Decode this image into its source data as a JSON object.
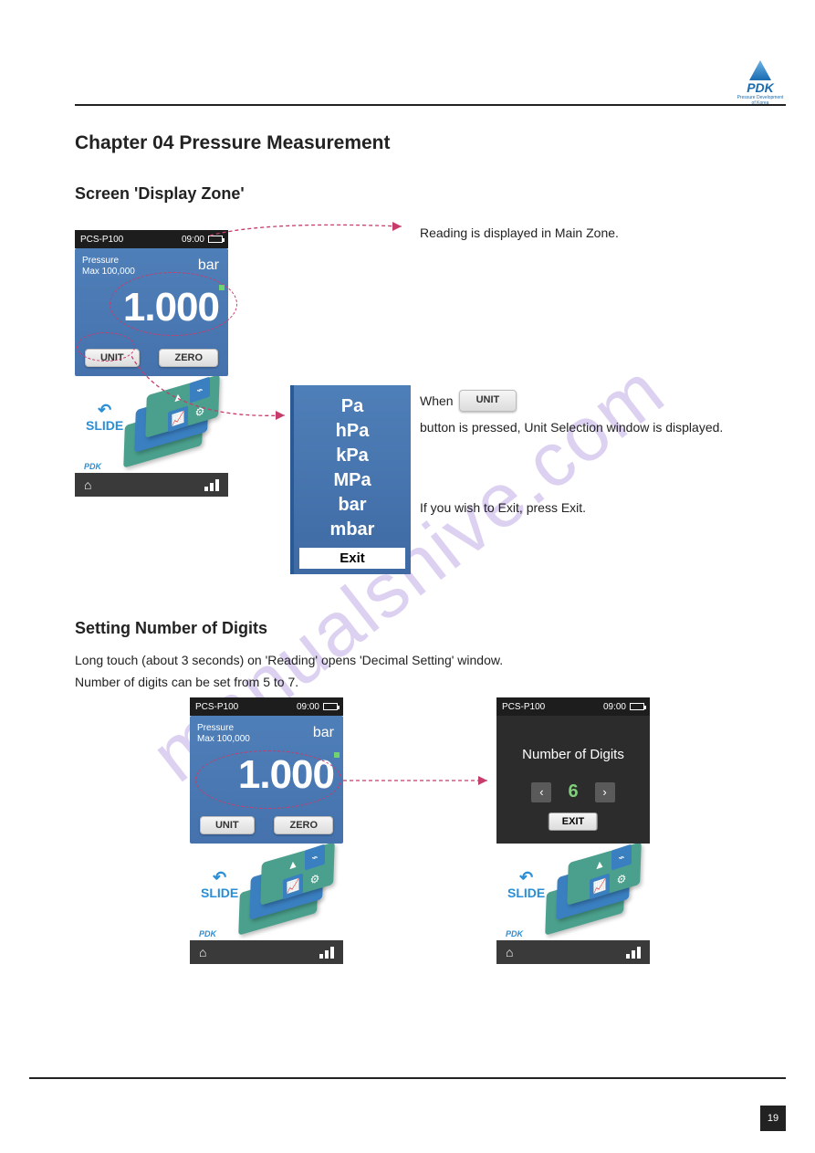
{
  "brand": {
    "name": "PDK",
    "tagline": "Pressure Development of Korea",
    "mark": "PDK"
  },
  "watermark": "manualshive.com",
  "page_number": "19",
  "section": "Chapter 04 Pressure Measurement",
  "seg1": {
    "heading": "Screen 'Display Zone'",
    "text1": "Reading is displayed in Main Zone.",
    "text2_a": "When ",
    "text2_b": " button is pressed, Unit Selection window is displayed.",
    "text3": "If you wish to Exit, press Exit."
  },
  "seg2": {
    "heading": "Setting Number of Digits",
    "text1": "Long touch (about 3 seconds) on 'Reading' opens 'Decimal Setting' window.",
    "text2": "Number of digits can be set from 5 to 7."
  },
  "device": {
    "model": "PCS-P100",
    "time": "09:00",
    "pressure_label": "Pressure",
    "max_label": "Max 100,000",
    "unit_display": "bar",
    "reading_value": "1.000",
    "unit_btn": "UNIT",
    "zero_btn": "ZERO",
    "slide_label": "SLIDE"
  },
  "unit_popup": {
    "options": [
      "Pa",
      "hPa",
      "kPa",
      "MPa",
      "bar",
      "mbar"
    ],
    "exit": "Exit"
  },
  "unit_button_standalone": "UNIT",
  "digits": {
    "title": "Number of Digits",
    "value": "6",
    "exit": "EXIT"
  }
}
